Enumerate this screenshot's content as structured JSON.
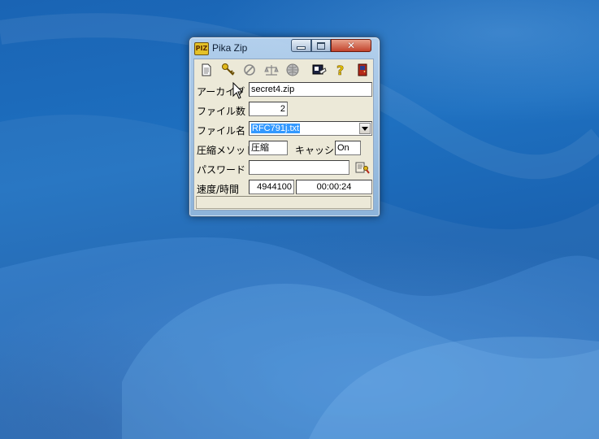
{
  "window": {
    "title": "Pika Zip",
    "app_icon_text": "PIZ",
    "close_glyph": "✕"
  },
  "toolbar": {
    "tools": [
      {
        "icon": "new-archive-icon"
      },
      {
        "icon": "key-icon"
      },
      {
        "icon": "stop-icon"
      },
      {
        "icon": "scale-icon"
      },
      {
        "icon": "globe-icon"
      },
      {
        "icon": "settings-icon"
      },
      {
        "icon": "help-icon"
      },
      {
        "icon": "exit-door-icon"
      }
    ]
  },
  "form": {
    "archive_label": "アーカイブ",
    "archive_value": "secret4.zip",
    "filecount_label": "ファイル数",
    "filecount_value": "2",
    "filename_label": "ファイル名",
    "filename_value": "RFC791j.txt",
    "method_label": "圧縮メソッド",
    "method_value": "圧縮",
    "cache_label": "キャッシュ",
    "cache_value": "On",
    "password_label": "パスワード",
    "password_value": "",
    "speed_label": "速度/時間",
    "speed_value": "4944100",
    "time_value": "00:00:24"
  },
  "status": {
    "text": ""
  },
  "colors": {
    "desktop": "#1b67b7",
    "selection": "#3399ff",
    "client_bg": "#ece9d8"
  }
}
